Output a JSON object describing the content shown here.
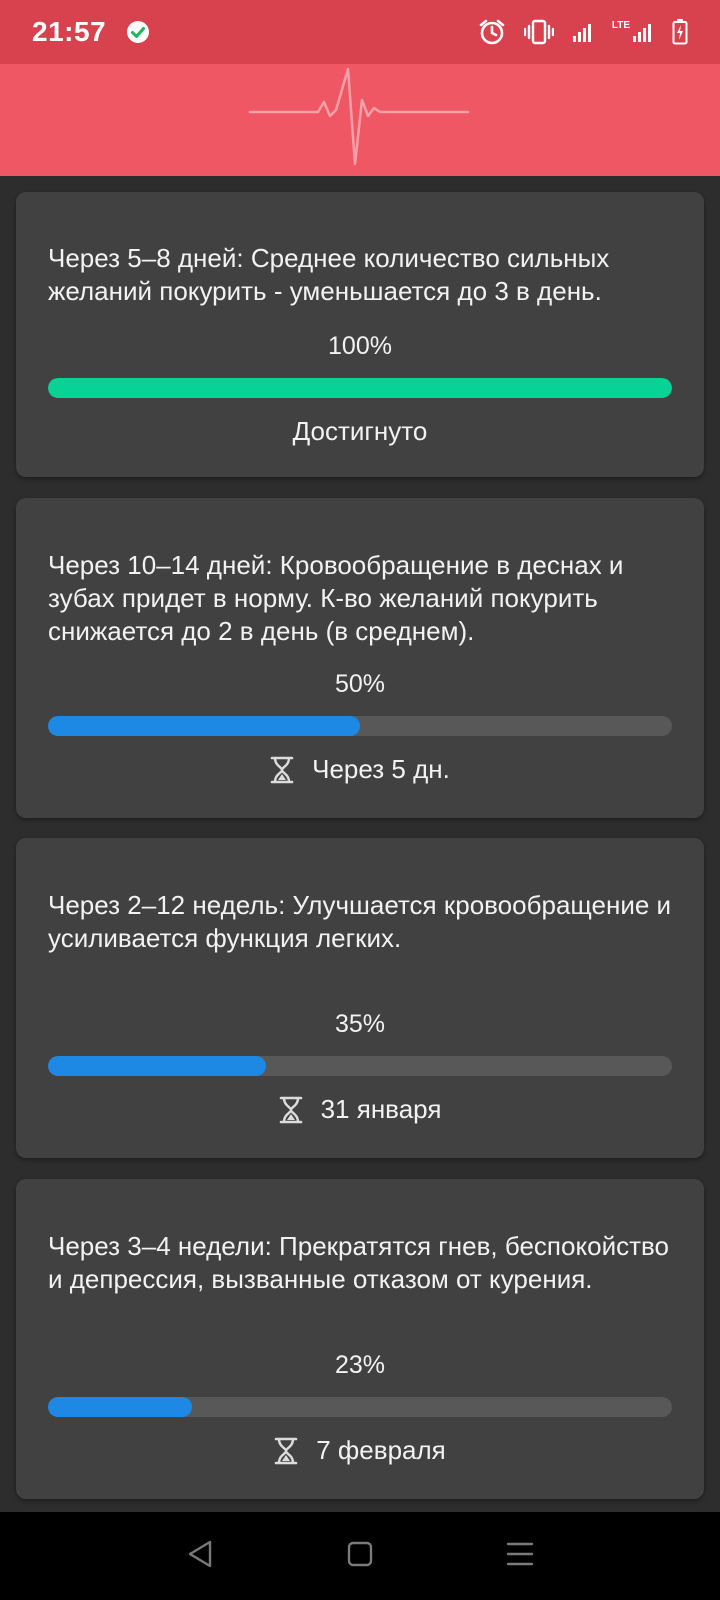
{
  "status_bar": {
    "time": "21:57",
    "network_label": "LTE",
    "icons": [
      "check-circle-icon",
      "alarm-icon",
      "vibrate-icon",
      "signal-icon",
      "lte-signal-icon",
      "battery-charging-icon"
    ]
  },
  "header": {
    "icon": "heartbeat-icon"
  },
  "colors": {
    "status_bar": "#d8424e",
    "header": "#f05764",
    "card_bg": "#414141",
    "page_bg": "#2d2d2d",
    "progress_done": "#08d296",
    "progress_active": "#1e88e5",
    "progress_track": "#585858"
  },
  "milestones": [
    {
      "text": "Через 5–8 дней: Среднее количество сильных желаний покурить - уменьшается до 3 в день.",
      "percent_label": "100%",
      "progress": 1.0,
      "status": "Достигнуто",
      "status_icon": null
    },
    {
      "text": "Через 10–14 дней: Кровообращение в деснах и зубах придет в норму. К-во желаний покурить снижается до 2 в день (в среднем).",
      "percent_label": "50%",
      "progress": 0.5,
      "status": "Через 5 дн.",
      "status_icon": "hourglass-icon"
    },
    {
      "text": "Через 2–12 недель: Улучшается кровообращение и усиливается функция легких.",
      "percent_label": "35%",
      "progress": 0.35,
      "status": "31 января",
      "status_icon": "hourglass-icon"
    },
    {
      "text": "Через 3–4 недели: Прекратятся гнев, беспокойство и депрессия, вызванные отказом от курения.",
      "percent_label": "23%",
      "progress": 0.23,
      "status": "7 февраля",
      "status_icon": "hourglass-icon"
    }
  ],
  "nav_bar": {
    "buttons": [
      "back-icon",
      "home-icon",
      "recents-icon"
    ]
  }
}
